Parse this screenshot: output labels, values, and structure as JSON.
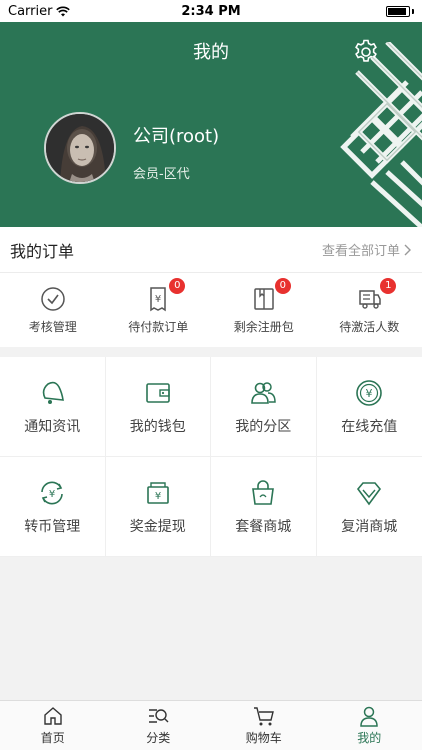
{
  "status_bar": {
    "carrier": "Carrier",
    "time": "2:34 PM"
  },
  "header": {
    "title": "我的",
    "username": "公司(root)",
    "member_level": "会员-区代",
    "bg_color": "#2b7555"
  },
  "orders": {
    "title": "我的订单",
    "view_all": "查看全部订单",
    "items": [
      {
        "label": "考核管理",
        "icon": "check-circle-icon",
        "badge": null
      },
      {
        "label": "待付款订单",
        "icon": "payment-receipt-icon",
        "badge": "0"
      },
      {
        "label": "剩余注册包",
        "icon": "package-book-icon",
        "badge": "0"
      },
      {
        "label": "待激活人数",
        "icon": "delivery-truck-icon",
        "badge": "1"
      }
    ]
  },
  "grid": [
    {
      "label": "通知资讯",
      "icon": "bell-icon"
    },
    {
      "label": "我的钱包",
      "icon": "wallet-icon"
    },
    {
      "label": "我的分区",
      "icon": "users-icon"
    },
    {
      "label": "在线充值",
      "icon": "yuan-coin-icon"
    },
    {
      "label": "转币管理",
      "icon": "currency-exchange-icon"
    },
    {
      "label": "奖金提现",
      "icon": "cash-withdraw-icon"
    },
    {
      "label": "套餐商城",
      "icon": "shopping-bag-icon"
    },
    {
      "label": "复消商城",
      "icon": "diamond-icon"
    }
  ],
  "tabbar": [
    {
      "label": "首页",
      "icon": "home-icon",
      "active": false
    },
    {
      "label": "分类",
      "icon": "category-search-icon",
      "active": false
    },
    {
      "label": "购物车",
      "icon": "cart-icon",
      "active": false
    },
    {
      "label": "我的",
      "icon": "user-icon",
      "active": true
    }
  ],
  "colors": {
    "accent": "#2b7555",
    "badge": "#e8312f"
  }
}
